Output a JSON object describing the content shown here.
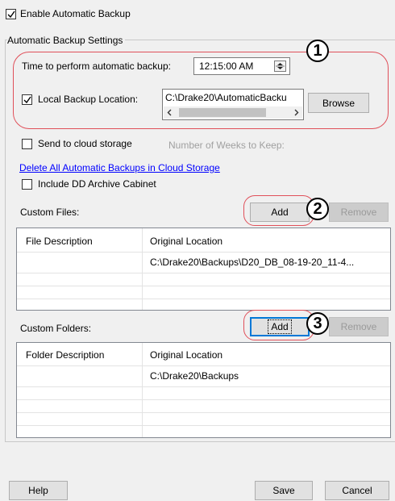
{
  "enable_backup": {
    "label": "Enable Automatic Backup",
    "checked": true
  },
  "settings_group": {
    "title": "Automatic Backup Settings"
  },
  "time": {
    "label": "Time to perform automatic backup:",
    "value": "12:15:00 AM"
  },
  "local_backup": {
    "label": "Local Backup Location:",
    "checked": true,
    "path": "C:\\Drake20\\AutomaticBacku",
    "browse_label": "Browse"
  },
  "cloud": {
    "label": "Send to cloud storage",
    "checked": false,
    "weeks_label": "Number of Weeks to Keep:"
  },
  "delete_link": "Delete All Automatic Backups in Cloud Storage",
  "include_dd": {
    "label": "Include DD Archive Cabinet",
    "checked": false
  },
  "custom_files": {
    "label": "Custom Files:",
    "add_label": "Add",
    "remove_label": "Remove",
    "columns": [
      "File Description",
      "Original Location"
    ],
    "rows": [
      [
        "",
        "C:\\Drake20\\Backups\\D20_DB_08-19-20_11-4..."
      ]
    ]
  },
  "custom_folders": {
    "label": "Custom Folders:",
    "add_label": "Add",
    "remove_label": "Remove",
    "columns": [
      "Folder Description",
      "Original Location"
    ],
    "rows": [
      [
        "",
        "C:\\Drake20\\Backups"
      ]
    ]
  },
  "callouts": [
    "1",
    "2",
    "3"
  ],
  "footer": {
    "help": "Help",
    "save": "Save",
    "cancel": "Cancel"
  },
  "colors": {
    "callout_outline": "#e0505a",
    "link": "#0000ff",
    "focus": "#0078d7"
  },
  "icons": {
    "checkbox_check": "check-icon",
    "spinner": "spin-up-down-icon",
    "scroll_left": "chevron-left-icon",
    "scroll_right": "chevron-right-icon"
  }
}
